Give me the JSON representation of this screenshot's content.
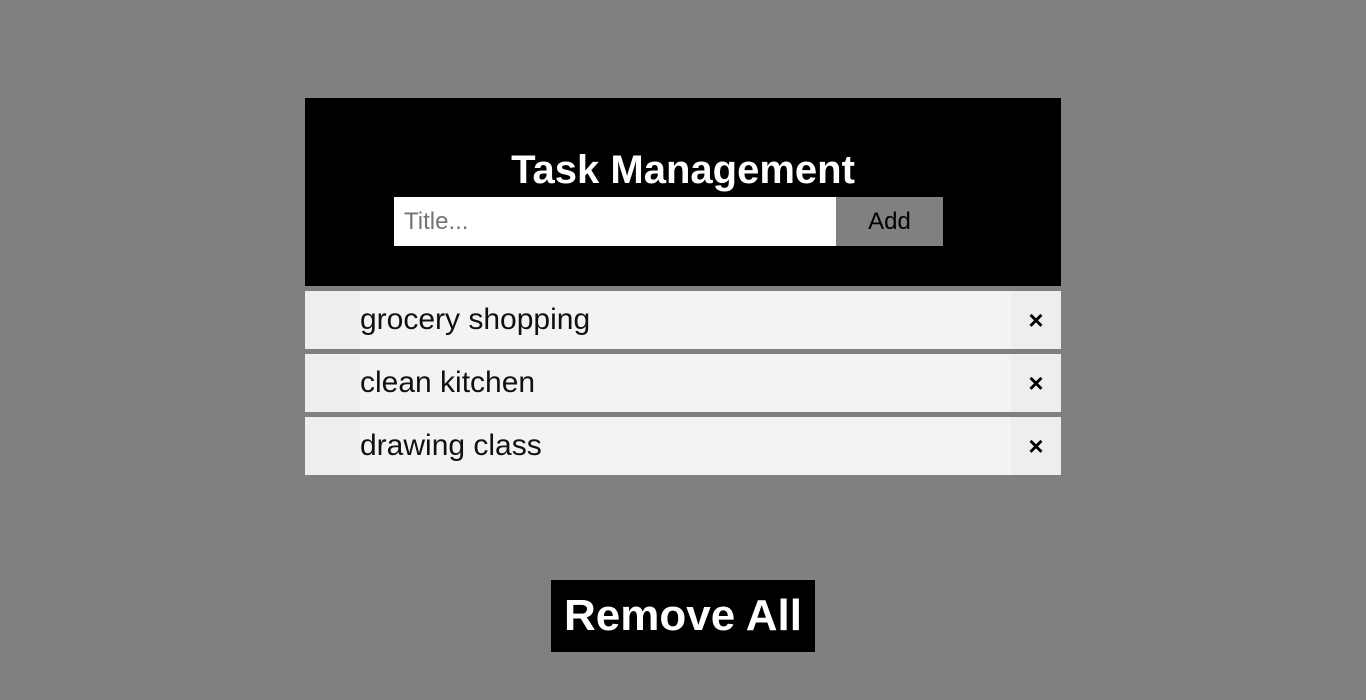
{
  "header": {
    "title": "Task Management",
    "input_placeholder": "Title...",
    "input_value": "",
    "add_label": "Add"
  },
  "tasks": [
    {
      "label": "grocery shopping",
      "close_glyph": "×"
    },
    {
      "label": "clean kitchen",
      "close_glyph": "×"
    },
    {
      "label": "drawing class",
      "close_glyph": "×"
    }
  ],
  "footer": {
    "remove_all_label": "Remove All"
  },
  "colors": {
    "background": "#808080",
    "header_bg": "#000000",
    "item_bg": "#f3f3f3",
    "button_bg": "#808080"
  }
}
